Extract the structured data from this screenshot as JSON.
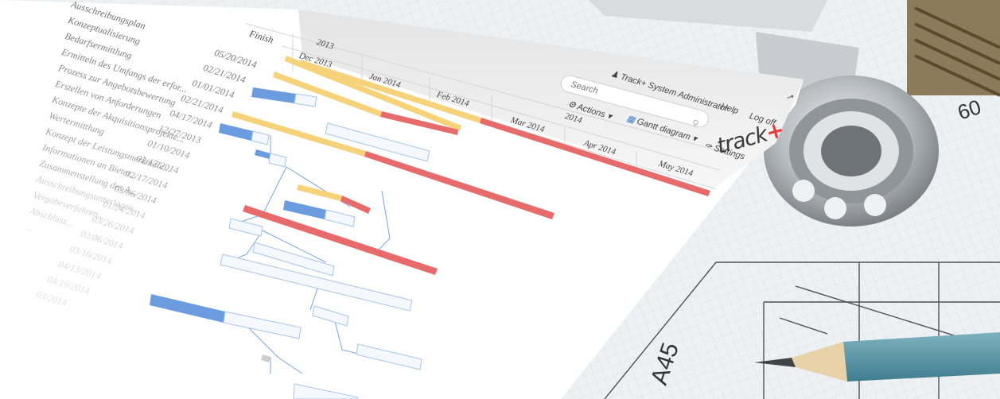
{
  "app": {
    "logo_text": "track",
    "logo_plus": "+",
    "user_label": "Track+ System Administrator",
    "help_label": "Help",
    "logoff_label": "Log off",
    "search_placeholder": "Search",
    "actions_label": "Actions",
    "view_label": "Gantt diagram",
    "settings_label": "Settings"
  },
  "columns": {
    "finish_header": "Finish"
  },
  "timeline": {
    "year_top": "2013",
    "year_2014": "2014",
    "months": [
      "Dec 2013",
      "Jan 2014",
      "Feb 2014",
      "Mar 2014",
      "Apr 2014",
      "May 2014"
    ]
  },
  "tasks": [
    {
      "name": "Ausschreibungsplan",
      "finish": ""
    },
    {
      "name": "Konzeptualisierung",
      "finish": "05/20/2014"
    },
    {
      "name": "Bedarfsermittlung",
      "finish": "02/21/2014"
    },
    {
      "name": "Ermitteln des Umfangs der erfor...",
      "finish": "01/01/2014"
    },
    {
      "name": "Prozess zur Angebotsbewertung",
      "finish": "02/21/2014"
    },
    {
      "name": "Erstellen von Anforderungen",
      "finish": "04/17/2014"
    },
    {
      "name": "Konzepte der Akquisitionsprojekte...",
      "finish": "12/27/2013"
    },
    {
      "name": "Wertermittlung",
      "finish": "01/10/2014"
    },
    {
      "name": "Konzept der Leistungsmerkmale...",
      "finish": "02/17/2014"
    },
    {
      "name": "Informationen an Bieter...",
      "finish": "02/17/2014"
    },
    {
      "name": "Zusammenstellung des A...",
      "finish": "03/06/2014"
    },
    {
      "name": "Ausschreibungsunterlagen...",
      "finish": "01/24/2014"
    },
    {
      "name": "Vergabeverfahren...",
      "finish": "03/26/2014"
    },
    {
      "name": "Abschluss...",
      "finish": "02/06/2014"
    },
    {
      "name": "...",
      "finish": "03/16/2014"
    },
    {
      "name": "",
      "finish": "04/13/2014"
    },
    {
      "name": "",
      "finish": "04/19/2014"
    },
    {
      "name": "",
      "finish": "03/2014"
    }
  ],
  "photo": {
    "ruler_number": "60",
    "drawing_label": "A45"
  },
  "colors": {
    "bar_yellow": "#f6d37b",
    "bar_red": "#e86b6b",
    "bar_blue": "#6c9ce0",
    "box_border": "#a8c4e8",
    "connector": "#7aa3dd",
    "logo_plus": "#e53b3b"
  }
}
